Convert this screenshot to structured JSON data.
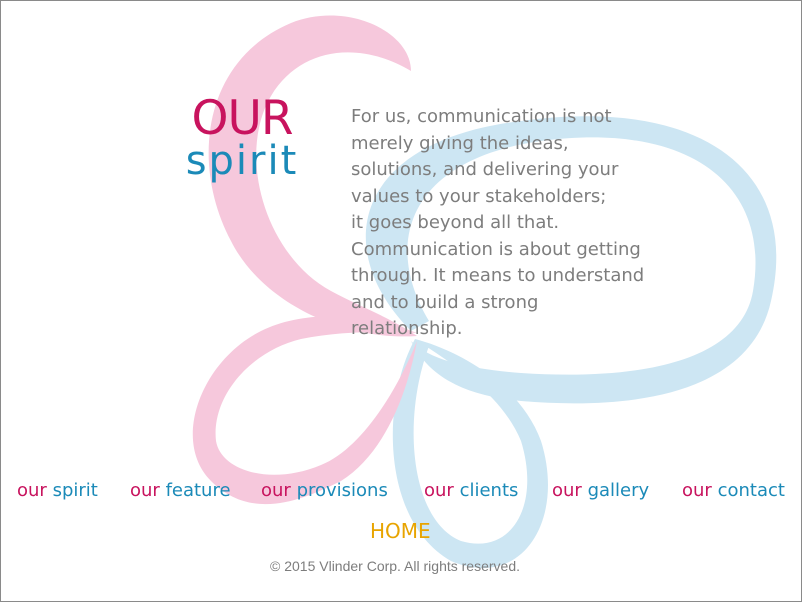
{
  "colors": {
    "brand_magenta": "#c8135e",
    "brand_blue": "#1b8ab8",
    "ribbon_pink": "#f6c8dc",
    "ribbon_blue": "#cde6f3",
    "home_gold": "#e8a400",
    "body_gray": "#7d7d7d"
  },
  "logo": {
    "line1": "OUR",
    "line2": "spirit"
  },
  "intro": {
    "text": "For us, communication is  not\nmerely giving the ideas,\nsolutions, and delivering your\nvalues to your stakeholders;\nit goes beyond all that.\nCommunication is about getting\nthrough. It means to understand\nand to build a strong\nrelationship."
  },
  "nav": {
    "items": [
      {
        "word1": "our",
        "word2": "spirit"
      },
      {
        "word1": "our",
        "word2": "feature"
      },
      {
        "word1": "our",
        "word2": "provisions"
      },
      {
        "word1": "our",
        "word2": "clients"
      },
      {
        "word1": "our",
        "word2": "gallery"
      },
      {
        "word1": "our",
        "word2": "contact"
      }
    ],
    "home": "HOME"
  },
  "footer": {
    "copyright": "© 2015 Vlinder Corp. All rights reserved."
  }
}
